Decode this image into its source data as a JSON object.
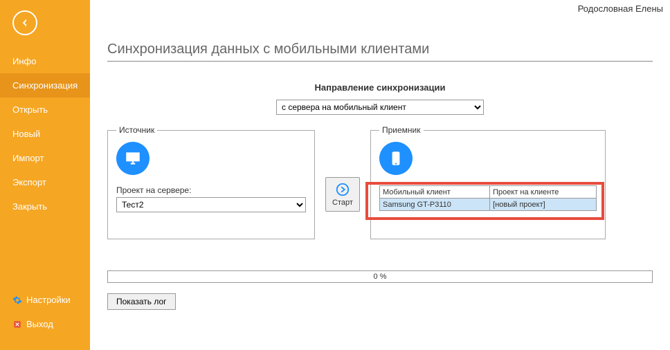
{
  "header": {
    "right_text": "Родословная Елены"
  },
  "sidebar": {
    "items": [
      {
        "label": "Инфо"
      },
      {
        "label": "Синхронизация"
      },
      {
        "label": "Открыть"
      },
      {
        "label": "Новый"
      },
      {
        "label": "Импорт"
      },
      {
        "label": "Экспорт"
      },
      {
        "label": "Закрыть"
      }
    ],
    "settings_label": "Настройки",
    "exit_label": "Выход"
  },
  "page": {
    "title": "Синхронизация данных с мобильными клиентами",
    "direction_label": "Направление синхронизации",
    "direction_value": "с сервера на мобильный клиент",
    "source": {
      "legend": "Источник",
      "field_label": "Проект на сервере:",
      "field_value": "Тест2"
    },
    "start_label": "Старт",
    "receiver": {
      "legend": "Приемник",
      "col1": "Мобильный клиент",
      "col2": "Проект на клиенте",
      "row1_c1": "Samsung GT-P3110",
      "row1_c2": "[новый проект]"
    },
    "progress_text": "0 %",
    "log_button": "Показать лог"
  }
}
